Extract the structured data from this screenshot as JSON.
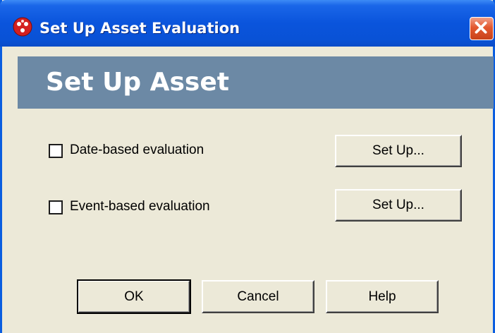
{
  "window": {
    "title": "Set Up Asset Evaluation",
    "header": "Set Up Asset",
    "title_bar_color": "#0a54dc",
    "header_band_color": "#6c89a5",
    "icons": {
      "app": "red-dots-app-icon",
      "close": "close-icon"
    }
  },
  "options": [
    {
      "label": "Date-based evaluation",
      "checked": false,
      "setup_label": "Set Up..."
    },
    {
      "label": "Event-based evaluation",
      "checked": false,
      "setup_label": "Set Up..."
    }
  ],
  "buttons": {
    "ok": "OK",
    "cancel": "Cancel",
    "help": "Help"
  }
}
